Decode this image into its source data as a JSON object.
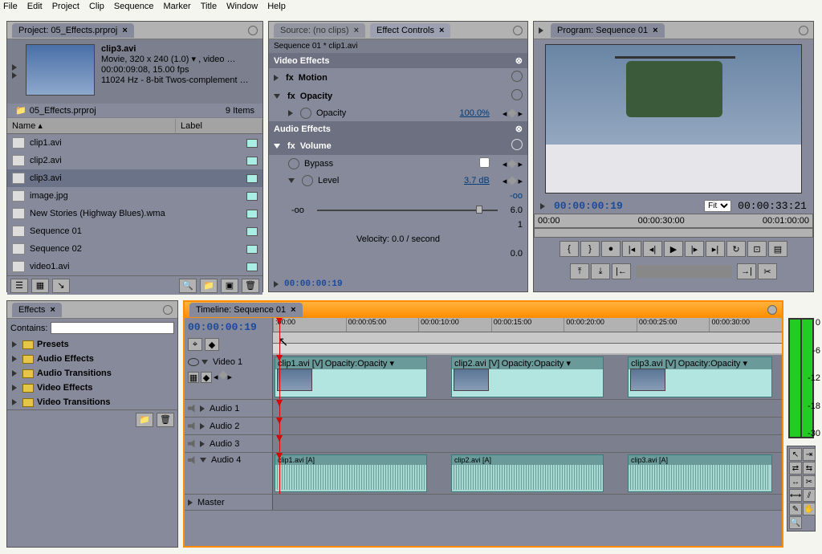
{
  "menu": [
    "File",
    "Edit",
    "Project",
    "Clip",
    "Sequence",
    "Marker",
    "Title",
    "Window",
    "Help"
  ],
  "project": {
    "title": "Project: 05_Effects.prproj",
    "selected": {
      "name": "clip3.avi",
      "meta1": "Movie, 320 x 240 (1.0)  ▾ , video …",
      "meta2": "00:00:09:08, 15.00 fps",
      "meta3": "11024 Hz - 8-bit Twos-complement …"
    },
    "filename": "05_Effects.prproj",
    "item_count": "9 Items",
    "cols": {
      "name": "Name",
      "label": "Label"
    },
    "items": [
      {
        "name": "clip1.avi",
        "type": "video"
      },
      {
        "name": "clip2.avi",
        "type": "video"
      },
      {
        "name": "clip3.avi",
        "type": "video",
        "selected": true
      },
      {
        "name": "image.jpg",
        "type": "image"
      },
      {
        "name": "New Stories (Highway Blues).wma",
        "type": "audio"
      },
      {
        "name": "Sequence 01",
        "type": "sequence"
      },
      {
        "name": "Sequence 02",
        "type": "sequence"
      },
      {
        "name": "video1.avi",
        "type": "video"
      }
    ]
  },
  "source": {
    "tab": "Source: (no clips)"
  },
  "effect_controls": {
    "tab": "Effect Controls",
    "path": "Sequence 01 * clip1.avi",
    "video_heading": "Video Effects",
    "motion": "Motion",
    "opacity": "Opacity",
    "opacity_val": "100.0%",
    "audio_heading": "Audio Effects",
    "volume": "Volume",
    "bypass": "Bypass",
    "level": "Level",
    "level_val": "3.7",
    "level_unit": "dB",
    "slider_min": "-oo",
    "slider_max": "6.0",
    "slider_right_val": "-oo",
    "velocity": "Velocity: 0.0 / second",
    "vel_max": "1",
    "vel_min": "0.0",
    "timecode": "00:00:00:19"
  },
  "program": {
    "tab": "Program: Sequence 01",
    "tc_current": "00:00:00:19",
    "tc_total": "00:00:33:21",
    "fit": "Fit",
    "ruler": [
      "00:00",
      "00:00:30:00",
      "00:01:00:00"
    ]
  },
  "effects": {
    "tab": "Effects",
    "contains": "Contains:",
    "folders": [
      "Presets",
      "Audio Effects",
      "Audio Transitions",
      "Video Effects",
      "Video Transitions"
    ]
  },
  "timeline": {
    "tab": "Timeline: Sequence 01",
    "tc": "00:00:00:19",
    "ruler": [
      ":00:00",
      "00:00:05:00",
      "00:00:10:00",
      "00:00:15:00",
      "00:00:20:00",
      "00:00:25:00",
      "00:00:30:00"
    ],
    "tracks": {
      "video1": "Video 1",
      "audio1": "Audio 1",
      "audio2": "Audio 2",
      "audio3": "Audio 3",
      "audio4": "Audio 4",
      "master": "Master"
    },
    "clips": [
      {
        "label": "clip1.avi [V]",
        "fx": "Opacity:Opacity ▾"
      },
      {
        "label": "clip2.avi [V]",
        "fx": "Opacity:Opacity ▾"
      },
      {
        "label": "clip3.avi [V]",
        "fx": "Opacity:Opacity ▾"
      }
    ],
    "audio_clips": [
      "clip1.avi [A]",
      "clip2.avi [A]",
      "clip3.avi [A]"
    ]
  },
  "meter_db": [
    "0",
    "-6",
    "-12",
    "-18",
    "-30"
  ]
}
